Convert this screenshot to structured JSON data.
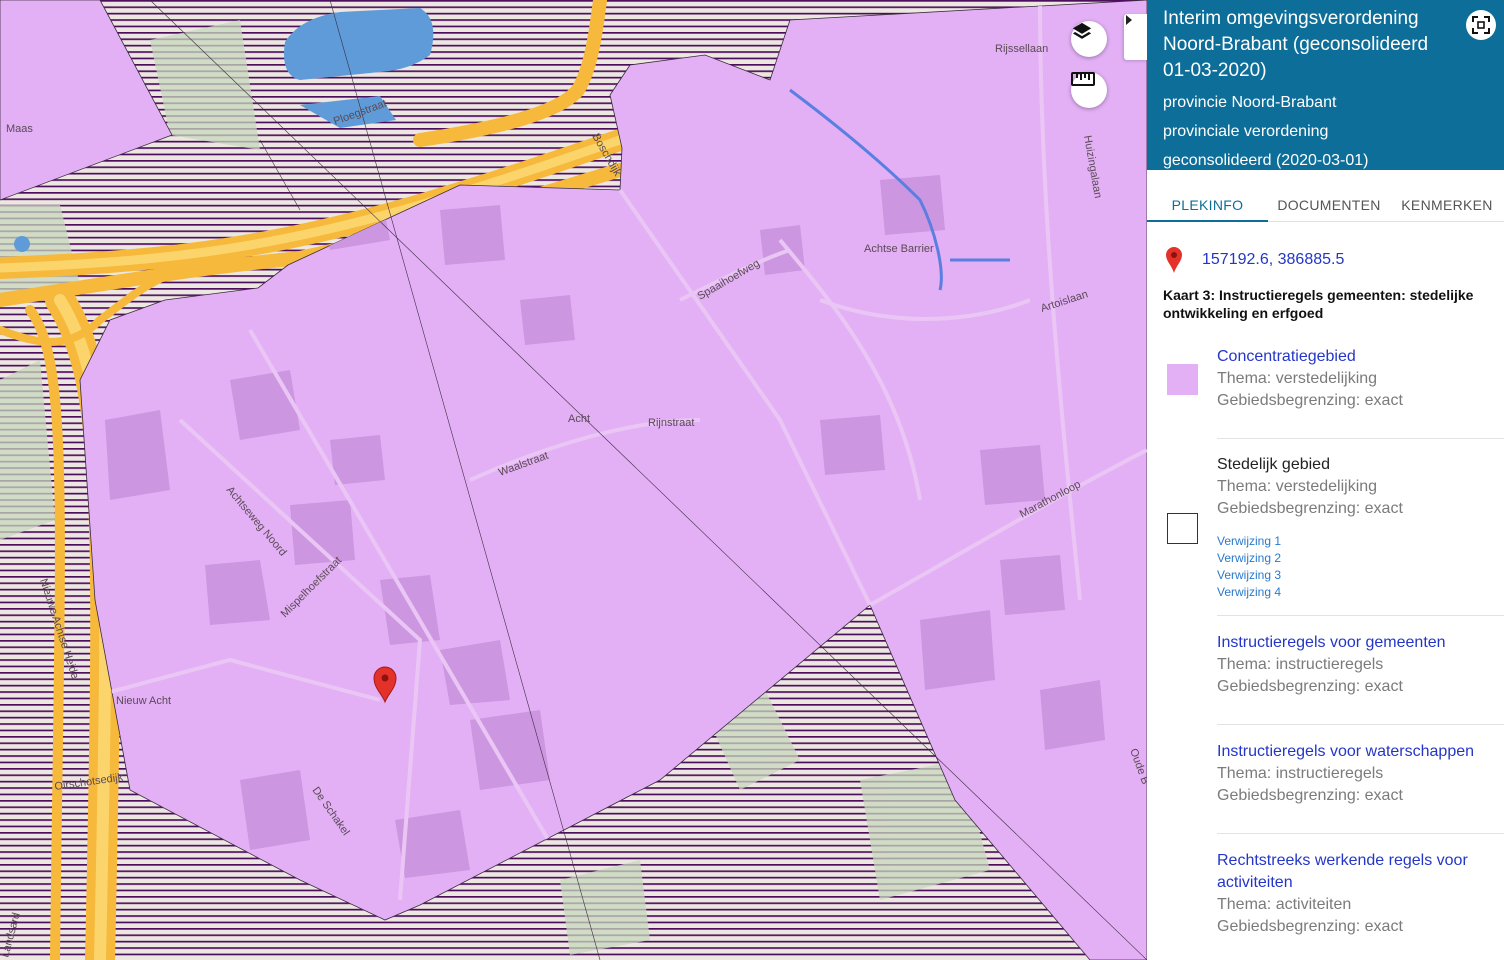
{
  "map": {
    "street_labels": [
      "Maas",
      "Ploegstraat",
      "Boschdijk",
      "Rijssellaan",
      "Huizingalaan",
      "Achtse Barrier",
      "Spaaihoefweg",
      "Artoislaan",
      "Acht",
      "Rijnstraat",
      "Waalstraat",
      "Marathonloop",
      "Achtseweg Noord",
      "Mispelhoefstraat",
      "Nieuwe Achtse Heide",
      "Nieuw Acht",
      "Oirschotsedijk",
      "De Schakel",
      "Landsard",
      "Oude B"
    ],
    "colors": {
      "base": "#e9e4dc",
      "concentration_area": "#e3b0f6",
      "hatch": "#4e0e60",
      "motorway": "#f6b93b",
      "water": "#5f9bd8",
      "green": "#c8d8bd",
      "marker": "#e4322b"
    }
  },
  "controls": {
    "layers_icon": "layers-icon",
    "measure_icon": "ruler-icon",
    "toggle_icon": "chevron-right-icon"
  },
  "panel": {
    "title": "Interim omgevingsverordening Noord-Brabant (geconsolideerd 01-03-2020)",
    "authority": "provincie Noord-Brabant",
    "doc_type": "provinciale verordening",
    "status": "geconsolideerd (2020-03-01)",
    "fullscreen_icon": "fullscreen-icon",
    "header_color": "#0d6e9a",
    "tabs": [
      {
        "label": "PLEKINFO"
      },
      {
        "label": "DOCUMENTEN"
      },
      {
        "label": "KENMERKEN"
      }
    ],
    "coordinates": "157192.6, 386885.5",
    "map_heading": "Kaart 3: Instructieregels gemeenten: stedelijke ontwikkeling en erfgoed",
    "items": [
      {
        "title": "Concentratiegebied",
        "theme": "Thema: verstedelijking",
        "boundary": "Gebiedsbegrenzing: exact",
        "swatch": "#e3b0f6"
      },
      {
        "title": "Stedelijk gebied",
        "theme": "Thema: verstedelijking",
        "boundary": "Gebiedsbegrenzing: exact",
        "refs": [
          "Verwijzing 1",
          "Verwijzing 2",
          "Verwijzing 3",
          "Verwijzing 4"
        ]
      },
      {
        "title": "Instructieregels voor gemeenten",
        "theme": "Thema: instructieregels",
        "boundary": "Gebiedsbegrenzing: exact"
      },
      {
        "title": "Instructieregels voor waterschappen",
        "theme": "Thema: instructieregels",
        "boundary": "Gebiedsbegrenzing: exact"
      },
      {
        "title": "Rechtstreeks werkende regels voor activiteiten",
        "theme": "Thema: activiteiten",
        "boundary": "Gebiedsbegrenzing: exact"
      }
    ]
  }
}
